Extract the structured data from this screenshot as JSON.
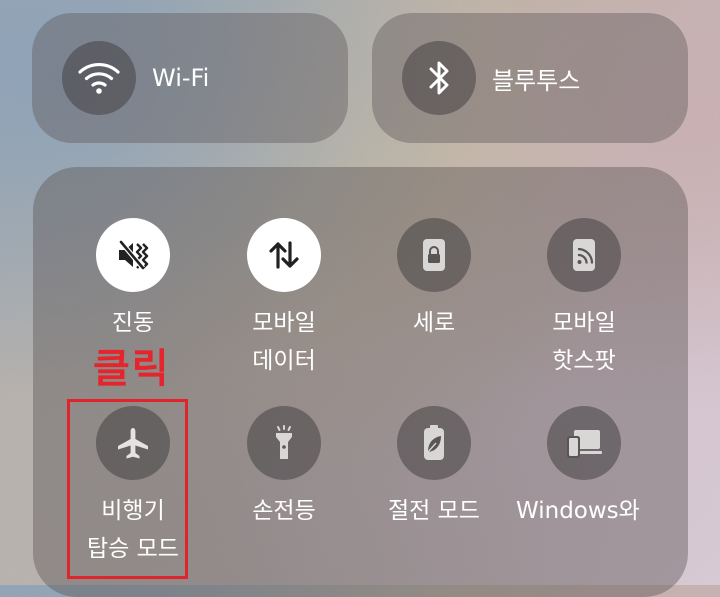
{
  "top_tiles": {
    "wifi": {
      "label": "Wi-Fi",
      "icon": "wifi-icon"
    },
    "bluetooth": {
      "label": "블루투스",
      "icon": "bluetooth-icon"
    }
  },
  "quick_settings": [
    {
      "label1": "진동",
      "label2": "",
      "icon": "vibrate-icon",
      "active": true
    },
    {
      "label1": "모바일",
      "label2": "데이터",
      "icon": "data-arrows-icon",
      "active": true
    },
    {
      "label1": "세로",
      "label2": "",
      "icon": "lock-icon",
      "active": false
    },
    {
      "label1": "모바일",
      "label2": "핫스팟",
      "icon": "hotspot-icon",
      "active": false
    },
    {
      "label1": "비행기",
      "label2": "탑승 모드",
      "icon": "airplane-icon",
      "active": false
    },
    {
      "label1": "손전등",
      "label2": "",
      "icon": "flashlight-icon",
      "active": false
    },
    {
      "label1": "절전 모드",
      "label2": "",
      "icon": "battery-leaf-icon",
      "active": false
    },
    {
      "label1": "Windows와",
      "label2": "",
      "icon": "link-to-windows-icon",
      "active": false
    }
  ],
  "annotation": {
    "click_label": "클릭",
    "color": "#e0242b"
  }
}
